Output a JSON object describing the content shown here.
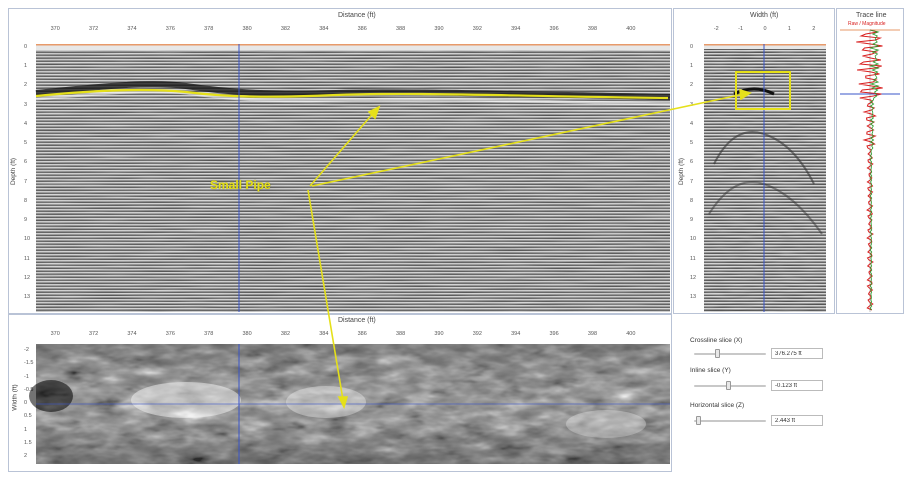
{
  "radargram": {
    "x_axis_title": "Distance (ft)",
    "y_axis_title": "Depth (ft)",
    "x_ticks": [
      "370",
      "372",
      "374",
      "376",
      "378",
      "380",
      "382",
      "384",
      "386",
      "388",
      "390",
      "392",
      "394",
      "396",
      "398",
      "400"
    ],
    "y_ticks": [
      "0",
      "1",
      "2",
      "3",
      "4",
      "5",
      "6",
      "7",
      "8",
      "9",
      "10",
      "11",
      "12",
      "13"
    ]
  },
  "crossline": {
    "x_axis_title": "Width (ft)",
    "y_axis_title": "Depth (ft)",
    "x_ticks": [
      "-2",
      "-1",
      "0",
      "1",
      "2"
    ],
    "y_ticks": [
      "0",
      "1",
      "2",
      "3",
      "4",
      "5",
      "6",
      "7",
      "8",
      "9",
      "10",
      "11",
      "12",
      "13"
    ]
  },
  "trace": {
    "title": "Trace line",
    "legend": "Raw / Magnitude",
    "raw_color": "#d81e1e",
    "magnitude_color": "#2a9a2a"
  },
  "depth_slice": {
    "x_axis_title": "Distance (ft)",
    "y_axis_title": "Width (ft)",
    "x_ticks": [
      "370",
      "372",
      "374",
      "376",
      "378",
      "380",
      "382",
      "384",
      "386",
      "388",
      "390",
      "392",
      "394",
      "396",
      "398",
      "400"
    ],
    "y_ticks": [
      "-2",
      "-1.5",
      "-1",
      "-0.5",
      "0",
      "0.5",
      "1",
      "1.5",
      "2"
    ]
  },
  "annotation": {
    "label": "Small Pipe",
    "color": "#e5e01a"
  },
  "controls": {
    "crossline": {
      "label": "Crossline slice (X)",
      "value": "376.275 ft",
      "position": 0.32
    },
    "inline": {
      "label": "Inline slice (Y)",
      "value": "-0.123 ft",
      "position": 0.47
    },
    "horizontal": {
      "label": "Horizontal slice (Z)",
      "value": "2.443 ft",
      "position": 0.05
    }
  },
  "icons": {
    "menu": "chevron-down-icon"
  },
  "colors": {
    "cursor_line": "#3a55c8",
    "frame": "#b9c3d6"
  }
}
